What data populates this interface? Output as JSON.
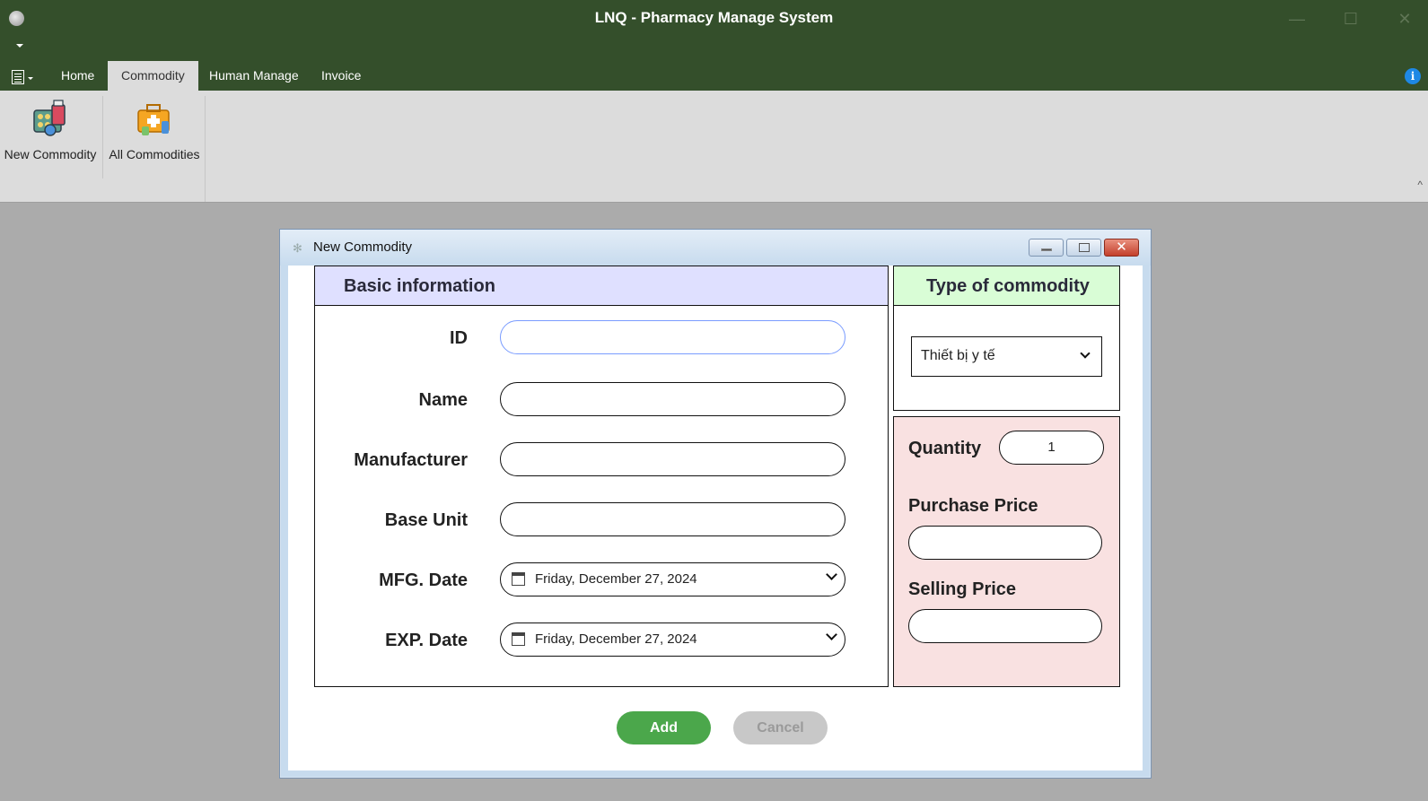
{
  "window": {
    "title": "LNQ - Pharmacy Manage System",
    "controls": {
      "minimize": "—",
      "maximize": "☐",
      "close": "✕"
    }
  },
  "ribbon": {
    "tabs": [
      {
        "label": "Home"
      },
      {
        "label": "Commodity",
        "active": true
      },
      {
        "label": "Human Manage"
      },
      {
        "label": "Invoice"
      }
    ],
    "buttons": [
      {
        "label": "New Commodity",
        "icon": "pills-icon"
      },
      {
        "label": "All Commodities",
        "icon": "medicine-box-icon"
      }
    ],
    "info_icon": "i",
    "collapse_icon": "^"
  },
  "dialog": {
    "title": "New Commodity",
    "basic": {
      "header": "Basic information",
      "fields": {
        "id": {
          "label": "ID",
          "value": ""
        },
        "name": {
          "label": "Name",
          "value": ""
        },
        "manufacturer": {
          "label": "Manufacturer",
          "value": ""
        },
        "base_unit": {
          "label": "Base Unit",
          "value": ""
        },
        "mfg_date": {
          "label": "MFG. Date",
          "value": "Friday, December 27, 2024"
        },
        "exp_date": {
          "label": "EXP. Date",
          "value": "Friday, December 27, 2024"
        }
      }
    },
    "type": {
      "header": "Type of commodity",
      "selected": "Thiết bị y tế"
    },
    "pricing": {
      "quantity": {
        "label": "Quantity",
        "value": "1"
      },
      "purchase_price": {
        "label": "Purchase Price",
        "value": ""
      },
      "selling_price": {
        "label": "Selling Price",
        "value": ""
      }
    },
    "actions": {
      "add": "Add",
      "cancel": "Cancel"
    }
  },
  "colors": {
    "titlebar": "#344f2b",
    "ribbon": "#dcdcdc",
    "basic_header": "#dfe0ff",
    "type_header": "#d9fdd6",
    "price_panel": "#f9e1e1",
    "add_button": "#4ba74b",
    "cancel_button": "#c8c8c8"
  }
}
